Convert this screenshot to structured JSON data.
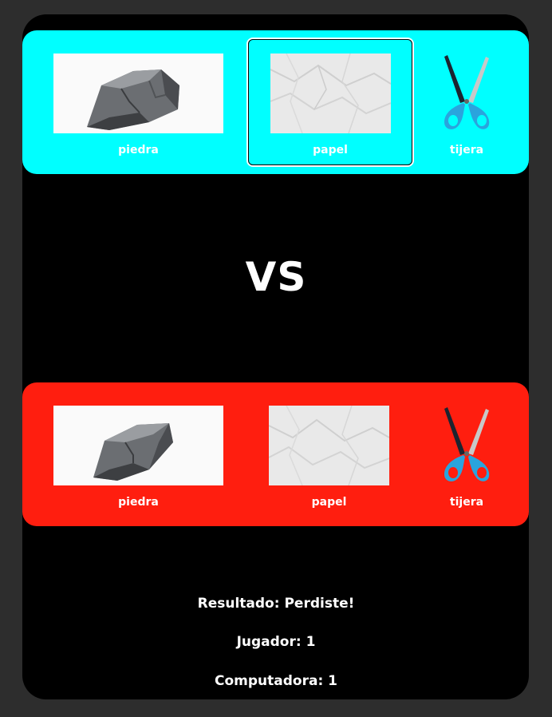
{
  "player_panel": {
    "color": "#00ffff",
    "selected": "papel",
    "choices": [
      {
        "label": "piedra",
        "icon": "rock-icon"
      },
      {
        "label": "papel",
        "icon": "paper-icon"
      },
      {
        "label": "tijera",
        "icon": "scissors-icon"
      }
    ]
  },
  "vs_text": "VS",
  "cpu_panel": {
    "color": "#ff1e0f",
    "choices": [
      {
        "label": "piedra",
        "icon": "rock-icon"
      },
      {
        "label": "papel",
        "icon": "paper-icon"
      },
      {
        "label": "tijera",
        "icon": "scissors-icon"
      }
    ]
  },
  "result": {
    "outcome_text": "Resultado: Perdiste!",
    "player_score_text": "Jugador: 1",
    "computer_score_text": "Computadora: 1"
  }
}
